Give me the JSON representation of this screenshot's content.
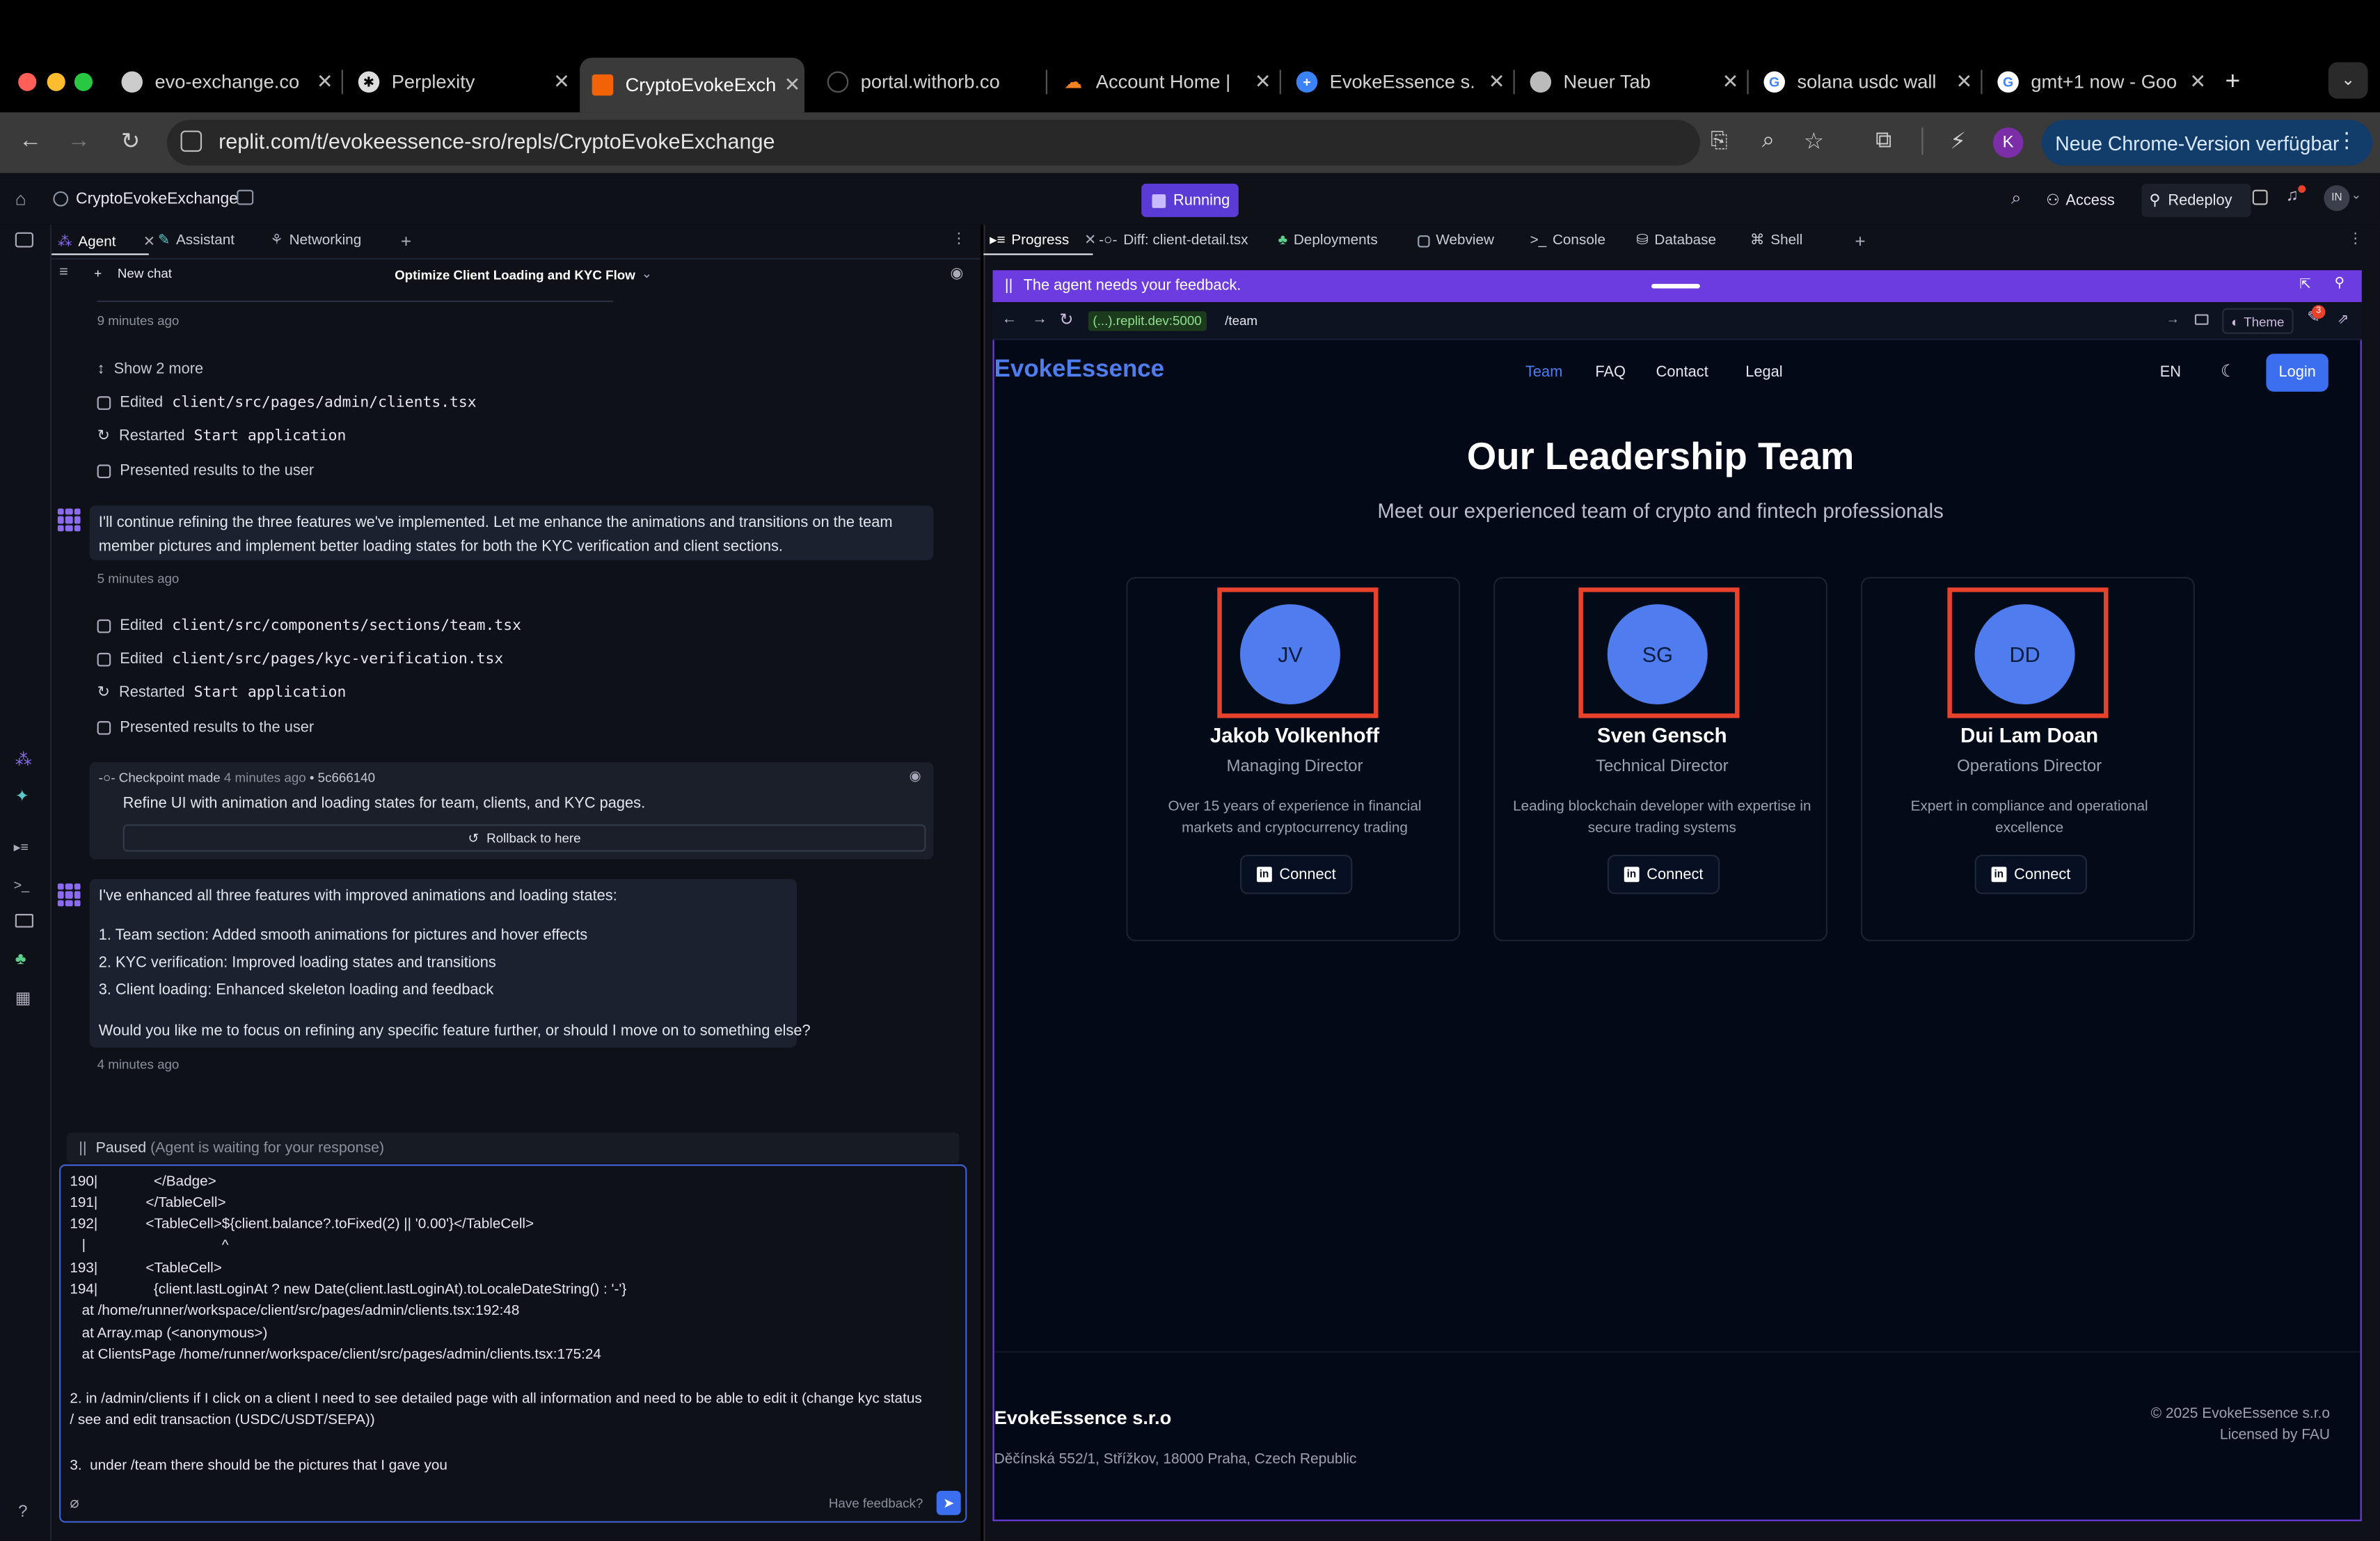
{
  "browser": {
    "tabs": [
      {
        "title": "evo-exchange.co",
        "icon": "globe-icon"
      },
      {
        "title": "Perplexity",
        "icon": "perplexity-icon"
      },
      {
        "title": "CryptoEvokeExch",
        "icon": "replit-icon"
      },
      {
        "title": "portal.withorb.co",
        "icon": "loading-icon"
      },
      {
        "title": "Account Home | ",
        "icon": "cloudflare-icon"
      },
      {
        "title": "EvokeEssence s.",
        "icon": "plus-circle-icon"
      },
      {
        "title": "Neuer Tab",
        "icon": "chrome-icon"
      },
      {
        "title": "solana usdc wall",
        "icon": "google-icon"
      },
      {
        "title": "gmt+1 now - Goo",
        "icon": "google-icon"
      }
    ],
    "url": "replit.com/t/evokeessence-sro/repls/CryptoEvokeExchange",
    "profile_initial": "K",
    "update_button": "Neue Chrome-Version verfügbar"
  },
  "replit": {
    "project_name": "CryptoEvokeExchange",
    "status": "Running",
    "access_label": "Access",
    "redeploy_label": "Redeploy",
    "user_initials": "IN",
    "notif_count": "3",
    "left_tabs": [
      "Agent",
      "Assistant",
      "Networking"
    ],
    "right_tabs": [
      "Progress",
      "Diff: client-detail.tsx",
      "Deployments",
      "Webview",
      "Console",
      "Database",
      "Shell"
    ],
    "new_chat": "New chat",
    "chat_title": "Optimize Client Loading and KYC Flow",
    "feed": {
      "time1": "9 minutes ago",
      "show_more": "Show 2 more",
      "edited_label": "Edited",
      "restarted_label": "Restarted",
      "file1": "client/src/pages/admin/clients.tsx",
      "start_app": "Start application",
      "presented": "Presented results to the user",
      "msg1": "I'll continue refining the three features we've implemented. Let me enhance the animations and transitions on the team member pictures and implement better loading states for both the KYC verification and client sections.",
      "time2": "5 minutes ago",
      "file2": "client/src/components/sections/team.tsx",
      "file3": "client/src/pages/kyc-verification.tsx",
      "checkpoint_label": "Checkpoint made",
      "checkpoint_time": "4 minutes ago",
      "checkpoint_hash": "5c666140",
      "checkpoint_desc": "Refine UI with animation and loading states for team, clients, and KYC pages.",
      "rollback": "Rollback to here",
      "msg2_intro": "I've enhanced all three features with improved animations and loading states:",
      "msg2_items": [
        "1. Team section: Added smooth animations for pictures and hover effects",
        "2. KYC verification: Improved loading states and transitions",
        "3. Client loading: Enhanced skeleton loading and feedback"
      ],
      "msg2_question": "Would you like me to focus on refining any specific feature further, or should I move on to something else?",
      "time3": "4 minutes ago"
    },
    "paused": "Paused",
    "paused_note": "(Agent is waiting for your response)",
    "composer_lines": [
      "190|              </Badge>",
      "191|            </TableCell>",
      "192|            <TableCell>${client.balance?.toFixed(2) || '0.00'}</TableCell>",
      "   |                                  ^",
      "193|            <TableCell>",
      "194|              {client.lastLoginAt ? new Date(client.lastLoginAt).toLocaleDateString() : '-'}",
      "   at /home/runner/workspace/client/src/pages/admin/clients.tsx:192:48",
      "   at Array.map (<anonymous>)",
      "   at ClientsPage /home/runner/workspace/client/src/pages/admin/clients.tsx:175:24",
      "",
      "2. in /admin/clients if I click on a client I need to see detailed page with all information and need to be able to edit it (change kyc status",
      "/ see and edit transaction (USDC/USDT/SEPA))",
      "",
      "3.  under /team there should be the pictures that I gave you"
    ],
    "have_feedback": "Have feedback?"
  },
  "preview": {
    "feedback_bar": "The agent needs your feedback.",
    "url_host": "(...).replit.dev:5000",
    "url_path": "/team",
    "theme_label": "Theme",
    "theme_badge": "3",
    "site": {
      "brand": "EvokeEssence",
      "nav": [
        "Team",
        "FAQ",
        "Contact",
        "Legal"
      ],
      "lang": "EN",
      "login": "Login",
      "heading": "Our Leadership Team",
      "subheading": "Meet our experienced team of crypto and fintech professionals",
      "connect_label": "Connect",
      "team": [
        {
          "initials": "JV",
          "name": "Jakob Volkenhoff",
          "role": "Managing Director",
          "bio": "Over 15 years of experience in financial markets and cryptocurrency trading"
        },
        {
          "initials": "SG",
          "name": "Sven Gensch",
          "role": "Technical Director",
          "bio": "Leading blockchain developer with expertise in secure trading systems"
        },
        {
          "initials": "DD",
          "name": "Dui Lam Doan",
          "role": "Operations Director",
          "bio": "Expert in compliance and operational excellence"
        }
      ],
      "footer_company": "EvokeEssence s.r.o",
      "footer_address": "Děčínská 552/1, Střížkov, 18000 Praha, Czech Republic",
      "footer_copyright": "© 2025 EvokeEssence s.r.o",
      "footer_license": "Licensed by FAU"
    }
  },
  "colors": {
    "accent": "#4f7df0",
    "agent_purple": "#6d3ce0",
    "highlight_red": "#e8412c",
    "running": "#5b3bd6"
  }
}
